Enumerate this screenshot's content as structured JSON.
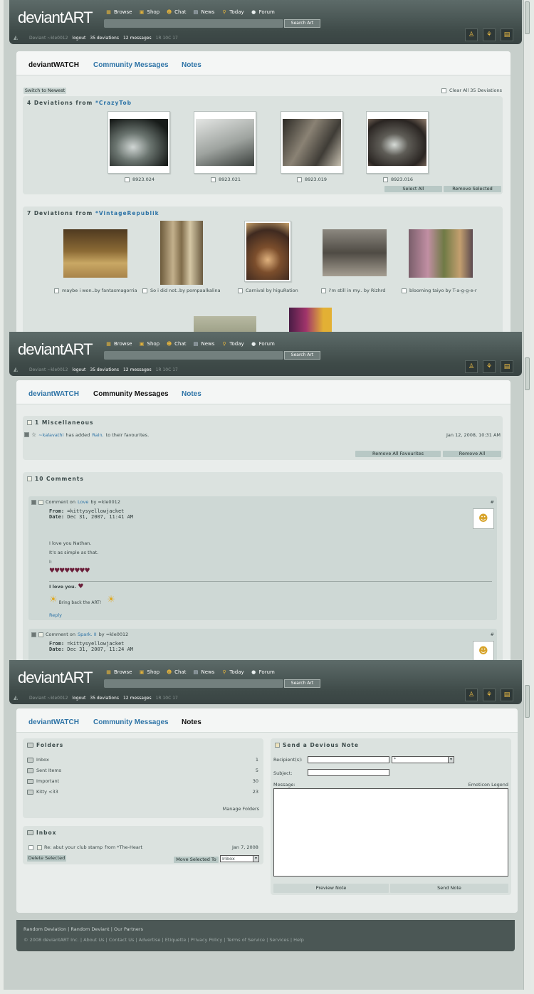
{
  "brand": {
    "logo": "deviantART"
  },
  "nav": {
    "browse": "Browse",
    "shop": "Shop",
    "chat": "Chat",
    "news": "News",
    "today": "Today",
    "forum": "Forum",
    "search_button": "Search Art"
  },
  "userbar": {
    "username": "Deviant ~kle0012",
    "logout": "logout",
    "deviations": "35 deviations",
    "messages": "12 messages",
    "extra": "1R 10C 17"
  },
  "tabs": {
    "watch": "deviantWATCH",
    "community": "Community Messages",
    "notes": "Notes"
  },
  "watch": {
    "switch_label": "Switch to Newest",
    "clear_all": "Clear All 35 Deviations",
    "group1": {
      "count_label": "4 Deviations from",
      "user": "*CrazyTob",
      "items": [
        "8923.024",
        "8923.021",
        "8923.019",
        "8923.016"
      ],
      "select_all": "Select All",
      "remove_selected": "Remove Selected"
    },
    "group2": {
      "count_label": "7 Deviations from",
      "user": "*VintageRepublik",
      "items": [
        "maybe i won..by fantasmagorria",
        "So i did not..by pompaalkalina",
        "Carnival by higuRation",
        "i'm still in my.. by Rizhrd",
        "blooming taiyo by T-a-g-g-e-r"
      ]
    }
  },
  "community": {
    "misc": {
      "title": "1 Miscellaneous",
      "line_user": "~kalavathi",
      "line_mid": "has added",
      "line_item": "Rain.",
      "line_end": "to their favourites.",
      "date": "Jan 12, 2008, 10:31 AM",
      "remove_favs": "Remove All Favourites",
      "remove_all": "Remove All"
    },
    "comments": {
      "title": "10 Comments",
      "c1": {
        "prefix": "Comment on",
        "item": "Love",
        "by": "by =kle0012",
        "hash": "#",
        "from_label": "From:",
        "from": "=kittysyellowjacket",
        "date_label": "Date:",
        "date": "Dec 31, 2007, 11:41 AM",
        "line1": "I love you Nathan.",
        "line2": "It's as simple as that.",
        "line3": "I:",
        "footer1": "I love you.",
        "footer2": "Bring back the ART!",
        "reply": "Reply"
      },
      "c2": {
        "prefix": "Comment on",
        "item": "Spark. II",
        "by": "by =kle0012",
        "hash": "#",
        "from_label": "From:",
        "from": "=kittysyellowjacket",
        "date_label": "Date:",
        "date": "Dec 31, 2007, 11:24 AM"
      }
    }
  },
  "notes": {
    "folders_title": "Folders",
    "folders": [
      {
        "name": "Inbox",
        "count": "1"
      },
      {
        "name": "Sent Items",
        "count": "5"
      },
      {
        "name": "Important",
        "count": "30"
      },
      {
        "name": "Kitty <33",
        "count": "23"
      }
    ],
    "manage": "Manage Folders",
    "inbox_title": "Inbox",
    "note_subject": "Re: abut your club stamp",
    "note_from": "from *The-Heart",
    "note_date": "Jan 7, 2008",
    "delete_selected": "Delete Selected",
    "move_selected": "Move Selected To",
    "move_value": "Inbox",
    "send_title": "Send a Devious Note",
    "recipients_label": "Recipient(s):",
    "recipient_select": "*",
    "subject_label": "Subject:",
    "message_label": "Message:",
    "emoticon_legend": "Emoticon Legend",
    "preview": "Preview Note",
    "send": "Send Note"
  },
  "footer": {
    "line1": "Random Deviation | Random Deviant | Our Partners",
    "line2": "© 2008 deviantART Inc. | About Us | Contact Us | Advertise | Etiquette | Privacy Policy | Terms of Service | Services | Help"
  }
}
